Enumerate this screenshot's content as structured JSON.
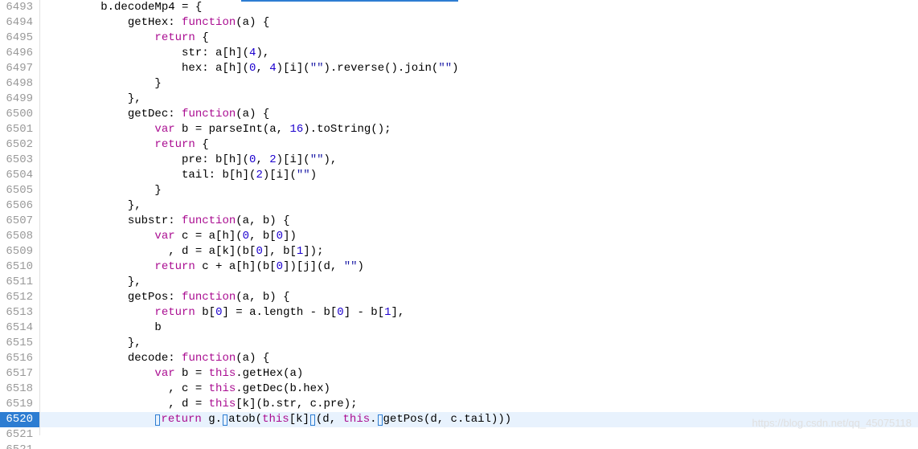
{
  "watermark": "https://blog.csdn.net/qq_45075118",
  "lineStart": 6493,
  "activeLine": 6520,
  "partialLastLine": 6521,
  "code": [
    {
      "indent": 8,
      "tokens": [
        {
          "t": "plain",
          "v": "b.decodeMp4 = {"
        }
      ]
    },
    {
      "indent": 12,
      "tokens": [
        {
          "t": "plain",
          "v": "getHex: "
        },
        {
          "t": "fn",
          "v": "function"
        },
        {
          "t": "plain",
          "v": "(a) {"
        }
      ]
    },
    {
      "indent": 16,
      "tokens": [
        {
          "t": "ret",
          "v": "return"
        },
        {
          "t": "plain",
          "v": " {"
        }
      ]
    },
    {
      "indent": 20,
      "tokens": [
        {
          "t": "plain",
          "v": "str: a[h]("
        },
        {
          "t": "num",
          "v": "4"
        },
        {
          "t": "plain",
          "v": "),"
        }
      ]
    },
    {
      "indent": 20,
      "tokens": [
        {
          "t": "plain",
          "v": "hex: a[h]("
        },
        {
          "t": "num",
          "v": "0"
        },
        {
          "t": "plain",
          "v": ", "
        },
        {
          "t": "num",
          "v": "4"
        },
        {
          "t": "plain",
          "v": ")[i]("
        },
        {
          "t": "str",
          "v": "\"\""
        },
        {
          "t": "plain",
          "v": ").reverse().join("
        },
        {
          "t": "str",
          "v": "\"\""
        },
        {
          "t": "plain",
          "v": ")"
        }
      ]
    },
    {
      "indent": 16,
      "tokens": [
        {
          "t": "plain",
          "v": "}"
        }
      ]
    },
    {
      "indent": 12,
      "tokens": [
        {
          "t": "plain",
          "v": "},"
        }
      ]
    },
    {
      "indent": 12,
      "tokens": [
        {
          "t": "plain",
          "v": "getDec: "
        },
        {
          "t": "fn",
          "v": "function"
        },
        {
          "t": "plain",
          "v": "(a) {"
        }
      ]
    },
    {
      "indent": 16,
      "tokens": [
        {
          "t": "var",
          "v": "var"
        },
        {
          "t": "plain",
          "v": " b = parseInt(a, "
        },
        {
          "t": "num",
          "v": "16"
        },
        {
          "t": "plain",
          "v": ").toString();"
        }
      ]
    },
    {
      "indent": 16,
      "tokens": [
        {
          "t": "ret",
          "v": "return"
        },
        {
          "t": "plain",
          "v": " {"
        }
      ]
    },
    {
      "indent": 20,
      "tokens": [
        {
          "t": "plain",
          "v": "pre: b[h]("
        },
        {
          "t": "num",
          "v": "0"
        },
        {
          "t": "plain",
          "v": ", "
        },
        {
          "t": "num",
          "v": "2"
        },
        {
          "t": "plain",
          "v": ")[i]("
        },
        {
          "t": "str",
          "v": "\"\""
        },
        {
          "t": "plain",
          "v": "),"
        }
      ]
    },
    {
      "indent": 20,
      "tokens": [
        {
          "t": "plain",
          "v": "tail: b[h]("
        },
        {
          "t": "num",
          "v": "2"
        },
        {
          "t": "plain",
          "v": ")[i]("
        },
        {
          "t": "str",
          "v": "\"\""
        },
        {
          "t": "plain",
          "v": ")"
        }
      ]
    },
    {
      "indent": 16,
      "tokens": [
        {
          "t": "plain",
          "v": "}"
        }
      ]
    },
    {
      "indent": 12,
      "tokens": [
        {
          "t": "plain",
          "v": "},"
        }
      ]
    },
    {
      "indent": 12,
      "tokens": [
        {
          "t": "plain",
          "v": "substr: "
        },
        {
          "t": "fn",
          "v": "function"
        },
        {
          "t": "plain",
          "v": "(a, b) {"
        }
      ]
    },
    {
      "indent": 16,
      "tokens": [
        {
          "t": "var",
          "v": "var"
        },
        {
          "t": "plain",
          "v": " c = a[h]("
        },
        {
          "t": "num",
          "v": "0"
        },
        {
          "t": "plain",
          "v": ", b["
        },
        {
          "t": "num",
          "v": "0"
        },
        {
          "t": "plain",
          "v": "])"
        }
      ]
    },
    {
      "indent": 18,
      "tokens": [
        {
          "t": "plain",
          "v": ", d = a[k](b["
        },
        {
          "t": "num",
          "v": "0"
        },
        {
          "t": "plain",
          "v": "], b["
        },
        {
          "t": "num",
          "v": "1"
        },
        {
          "t": "plain",
          "v": "]);"
        }
      ]
    },
    {
      "indent": 16,
      "tokens": [
        {
          "t": "ret",
          "v": "return"
        },
        {
          "t": "plain",
          "v": " c + a[h](b["
        },
        {
          "t": "num",
          "v": "0"
        },
        {
          "t": "plain",
          "v": "])[j](d, "
        },
        {
          "t": "str",
          "v": "\"\""
        },
        {
          "t": "plain",
          "v": ")"
        }
      ]
    },
    {
      "indent": 12,
      "tokens": [
        {
          "t": "plain",
          "v": "},"
        }
      ]
    },
    {
      "indent": 12,
      "tokens": [
        {
          "t": "plain",
          "v": "getPos: "
        },
        {
          "t": "fn",
          "v": "function"
        },
        {
          "t": "plain",
          "v": "(a, b) {"
        }
      ]
    },
    {
      "indent": 16,
      "tokens": [
        {
          "t": "ret",
          "v": "return"
        },
        {
          "t": "plain",
          "v": " b["
        },
        {
          "t": "num",
          "v": "0"
        },
        {
          "t": "plain",
          "v": "] = a.length - b["
        },
        {
          "t": "num",
          "v": "0"
        },
        {
          "t": "plain",
          "v": "] - b["
        },
        {
          "t": "num",
          "v": "1"
        },
        {
          "t": "plain",
          "v": "],"
        }
      ]
    },
    {
      "indent": 16,
      "tokens": [
        {
          "t": "plain",
          "v": "b"
        }
      ]
    },
    {
      "indent": 12,
      "tokens": [
        {
          "t": "plain",
          "v": "},"
        }
      ]
    },
    {
      "indent": 12,
      "tokens": [
        {
          "t": "plain",
          "v": "decode: "
        },
        {
          "t": "fn",
          "v": "function"
        },
        {
          "t": "plain",
          "v": "(a) {"
        }
      ]
    },
    {
      "indent": 16,
      "tokens": [
        {
          "t": "var",
          "v": "var"
        },
        {
          "t": "plain",
          "v": " b = "
        },
        {
          "t": "this",
          "v": "this"
        },
        {
          "t": "plain",
          "v": ".getHex(a)"
        }
      ]
    },
    {
      "indent": 18,
      "tokens": [
        {
          "t": "plain",
          "v": ", c = "
        },
        {
          "t": "this",
          "v": "this"
        },
        {
          "t": "plain",
          "v": ".getDec(b.hex)"
        }
      ]
    },
    {
      "indent": 18,
      "tokens": [
        {
          "t": "plain",
          "v": ", d = "
        },
        {
          "t": "this",
          "v": "this"
        },
        {
          "t": "plain",
          "v": "[k](b.str, c.pre);"
        }
      ]
    },
    {
      "indent": 16,
      "tokens": [
        {
          "t": "cursor",
          "v": ""
        },
        {
          "t": "ret",
          "v": "return"
        },
        {
          "t": "plain",
          "v": " g."
        },
        {
          "t": "cursor",
          "v": ""
        },
        {
          "t": "plain",
          "v": "atob("
        },
        {
          "t": "this",
          "v": "this"
        },
        {
          "t": "plain",
          "v": "[k]"
        },
        {
          "t": "cursor",
          "v": ""
        },
        {
          "t": "plain",
          "v": "(d, "
        },
        {
          "t": "this",
          "v": "this"
        },
        {
          "t": "plain",
          "v": "."
        },
        {
          "t": "cursor",
          "v": ""
        },
        {
          "t": "plain",
          "v": "getPos(d, c.tail)))"
        }
      ]
    },
    {
      "indent": 12,
      "tokens": [
        {
          "t": "plain",
          "v": ""
        }
      ]
    }
  ]
}
